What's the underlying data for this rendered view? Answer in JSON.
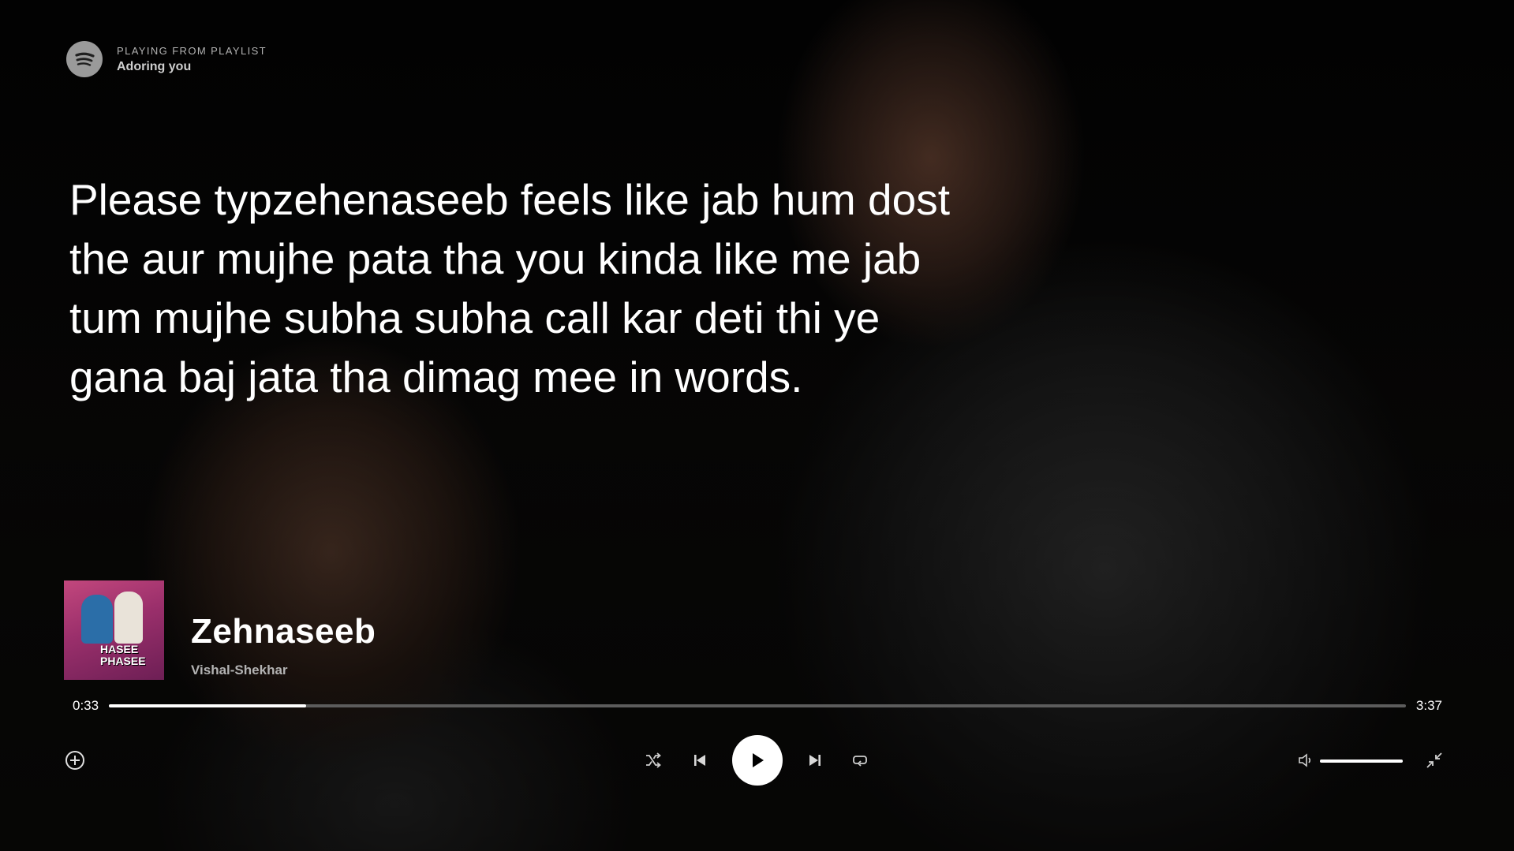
{
  "header": {
    "caption": "PLAYING FROM PLAYLIST",
    "playlist": "Adoring you",
    "logo_icon": "spotify-logo-icon"
  },
  "lyrics": {
    "text": "Please typzehenaseeb feels like jab hum dost the aur mujhe pata tha you kinda like me jab tum mujhe subha subha call kar deti thi ye gana baj jata tha dimag mee in words."
  },
  "track": {
    "title": "Zehnaseeb",
    "artist": "Vishal-Shekhar",
    "cover_text": "HASEE PHASEE"
  },
  "progress": {
    "elapsed": "0:33",
    "total": "3:37",
    "fraction": 0.152
  },
  "controls": {
    "add_icon": "add-circle-icon",
    "shuffle_icon": "shuffle-icon",
    "previous_icon": "skip-previous-icon",
    "play_icon": "play-icon",
    "next_icon": "skip-next-icon",
    "repeat_icon": "repeat-icon",
    "volume_icon": "volume-icon",
    "minimize_icon": "minimize-icon"
  },
  "volume": {
    "fraction": 1.0
  },
  "colors": {
    "accent": "#ffffff",
    "muted_text": "#b3b3b3",
    "track_bg": "#5c5c5c"
  }
}
